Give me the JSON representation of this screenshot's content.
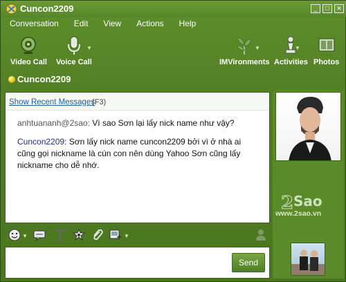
{
  "window": {
    "title": "Cuncon2209"
  },
  "menu": [
    "Conversation",
    "Edit",
    "View",
    "Actions",
    "Help"
  ],
  "toolbar": {
    "video_call": "Video Call",
    "voice_call": "Voice Call",
    "imvironments": "IMVironments",
    "activities": "Activities",
    "photos": "Photos"
  },
  "contact": {
    "name": "Cuncon2209",
    "status_color": "#f0c000"
  },
  "chat": {
    "recent_link": "Show Recent Messages",
    "recent_key": "(F3)",
    "messages": [
      {
        "sender": "anhtuananh@2sao:",
        "text": " Vì sao Sơn lại lấy nick name như vậy?"
      },
      {
        "sender": "Cuncon2209:",
        "text": " Sơn lấy nick name cuncon2209 bởi vì ở nhà ai cũng gọi nickname là cún con nên dùng Yahoo Sơn cũng lấy nickname cho dễ nhớ."
      }
    ]
  },
  "sidebar": {
    "watermark": "www.2sao.vn"
  },
  "input": {
    "send_label": "Send"
  },
  "colors": {
    "accent": "#4f7c22",
    "link": "#1f5fa8",
    "sender_highlight": "#1f2f8a"
  }
}
